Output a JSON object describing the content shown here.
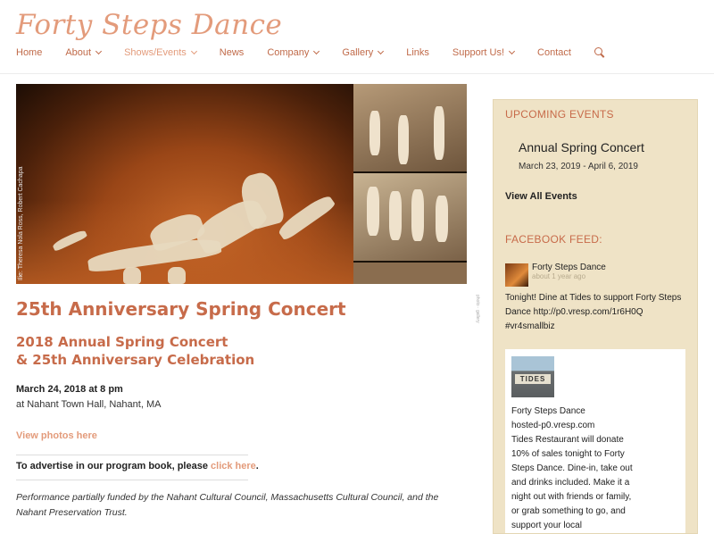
{
  "site": {
    "title": "Forty Steps Dance"
  },
  "nav": {
    "items": [
      {
        "label": "Home",
        "dropdown": false
      },
      {
        "label": "About",
        "dropdown": true
      },
      {
        "label": "Shows/Events",
        "dropdown": true
      },
      {
        "label": "News",
        "dropdown": false
      },
      {
        "label": "Company",
        "dropdown": true
      },
      {
        "label": "Gallery",
        "dropdown": true
      },
      {
        "label": "Links",
        "dropdown": false
      },
      {
        "label": "Support Us!",
        "dropdown": true
      },
      {
        "label": "Contact",
        "dropdown": false
      }
    ],
    "search_icon": "search-icon"
  },
  "hero": {
    "photo_credit": "Ilie: Theresa Nola Ross, Robert Cachapa"
  },
  "main": {
    "title": "25th Anniversary Spring Concert",
    "subtitle_line1": "2018 Annual Spring Concert",
    "subtitle_line2": "& 25th Anniversary Celebration",
    "date": "March 24, 2018 at 8 pm",
    "venue": "at Nahant Town Hall, Nahant, MA",
    "photos_link": "View photos here",
    "advertise_text": "To advertise in our program book, please ",
    "advertise_link": "click here",
    "advertise_end": ".",
    "funding": "Performance partially funded by the Nahant Cultural Council, Massachusetts Cultural Council, and the Nahant Preservation Trust."
  },
  "sidebar": {
    "upcoming_heading": "UPCOMING EVENTS",
    "event_title": "Annual Spring Concert",
    "event_dates": "March 23, 2019 - April 6, 2019",
    "view_all": "View All Events",
    "facebook_heading": "FACEBOOK FEED:",
    "fb_name": "Forty Steps Dance",
    "fb_time": "about 1 year ago",
    "fb_post": "Tonight! Dine at Tides to support Forty Steps Dance http://p0.vresp.com/1r6H0Q #vr4smallbiz",
    "fb_thumb_sign": "TIDES",
    "fb_card_name": "Forty Steps Dance",
    "fb_card_host": "hosted-p0.vresp.com",
    "fb_card_text": "Tides Restaurant will donate 10% of sales tonight to Forty Steps Dance. Dine-in, take out and drinks included. Make it a night out with friends or family, or grab something to go, and support your local"
  },
  "colors": {
    "accent": "#c76b4a",
    "title_accent": "#e39b7b",
    "sidebar_bg": "#efe3c6"
  }
}
